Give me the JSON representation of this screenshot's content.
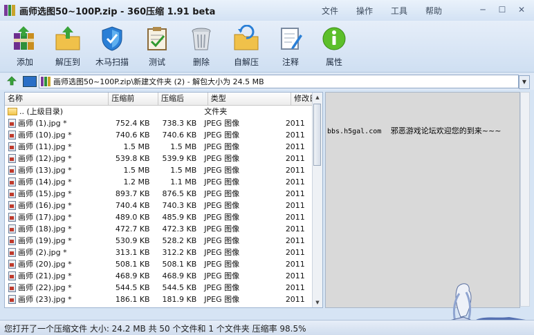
{
  "window": {
    "title": "画师选图50~100P.zip - 360压缩 1.91 beta",
    "menu": [
      "文件",
      "操作",
      "工具",
      "帮助"
    ],
    "controls": {
      "minimize": "─",
      "maximize": "☐",
      "close": "✕"
    }
  },
  "toolbar": [
    {
      "id": "add",
      "label": "添加"
    },
    {
      "id": "extract",
      "label": "解压到"
    },
    {
      "id": "scan",
      "label": "木马扫描"
    },
    {
      "id": "test",
      "label": "测试"
    },
    {
      "id": "delete",
      "label": "删除"
    },
    {
      "id": "selfextract",
      "label": "自解压"
    },
    {
      "id": "comment",
      "label": "注释"
    },
    {
      "id": "properties",
      "label": "属性"
    }
  ],
  "address": {
    "path": "画师选图50~100P.zip\\新建文件夹 (2) - 解包大小为 24.5 MB"
  },
  "list": {
    "columns": [
      "名称",
      "压缩前",
      "压缩后",
      "类型",
      "修改日"
    ],
    "rows": [
      {
        "name": ".. (上级目录)",
        "before": "",
        "after": "",
        "type": "文件夹",
        "mod": "",
        "folder": true
      },
      {
        "name": "画师 (1).jpg *",
        "before": "752.4 KB",
        "after": "738.3 KB",
        "type": "JPEG 图像",
        "mod": "2011"
      },
      {
        "name": "画师 (10).jpg *",
        "before": "740.6 KB",
        "after": "740.6 KB",
        "type": "JPEG 图像",
        "mod": "2011"
      },
      {
        "name": "画师 (11).jpg *",
        "before": "1.5 MB",
        "after": "1.5 MB",
        "type": "JPEG 图像",
        "mod": "2011"
      },
      {
        "name": "画师 (12).jpg *",
        "before": "539.8 KB",
        "after": "539.9 KB",
        "type": "JPEG 图像",
        "mod": "2011"
      },
      {
        "name": "画师 (13).jpg *",
        "before": "1.5 MB",
        "after": "1.5 MB",
        "type": "JPEG 图像",
        "mod": "2011"
      },
      {
        "name": "画师 (14).jpg *",
        "before": "1.2 MB",
        "after": "1.1 MB",
        "type": "JPEG 图像",
        "mod": "2011"
      },
      {
        "name": "画师 (15).jpg *",
        "before": "893.7 KB",
        "after": "876.5 KB",
        "type": "JPEG 图像",
        "mod": "2011"
      },
      {
        "name": "画师 (16).jpg *",
        "before": "740.4 KB",
        "after": "740.3 KB",
        "type": "JPEG 图像",
        "mod": "2011"
      },
      {
        "name": "画师 (17).jpg *",
        "before": "489.0 KB",
        "after": "485.9 KB",
        "type": "JPEG 图像",
        "mod": "2011"
      },
      {
        "name": "画师 (18).jpg *",
        "before": "472.7 KB",
        "after": "472.3 KB",
        "type": "JPEG 图像",
        "mod": "2011"
      },
      {
        "name": "画师 (19).jpg *",
        "before": "530.9 KB",
        "after": "528.2 KB",
        "type": "JPEG 图像",
        "mod": "2011"
      },
      {
        "name": "画师 (2).jpg *",
        "before": "313.1 KB",
        "after": "312.2 KB",
        "type": "JPEG 图像",
        "mod": "2011"
      },
      {
        "name": "画师 (20).jpg *",
        "before": "508.1 KB",
        "after": "508.1 KB",
        "type": "JPEG 图像",
        "mod": "2011"
      },
      {
        "name": "画师 (21).jpg *",
        "before": "468.9 KB",
        "after": "468.9 KB",
        "type": "JPEG 图像",
        "mod": "2011"
      },
      {
        "name": "画师 (22).jpg *",
        "before": "544.5 KB",
        "after": "544.5 KB",
        "type": "JPEG 图像",
        "mod": "2011"
      },
      {
        "name": "画师 (23).jpg *",
        "before": "186.1 KB",
        "after": "181.9 KB",
        "type": "JPEG 图像",
        "mod": "2011"
      }
    ]
  },
  "info_pane": {
    "url": "bbs.h5gal.com",
    "message": "邪恶游戏论坛欢迎您的到来~~~"
  },
  "status": {
    "text": "您打开了一个压缩文件 大小: 24.2 MB 共 50 个文件和 1 个文件夹 压缩率 98.5%"
  },
  "colors": {
    "accent": "#2b6fc6",
    "window_bg": "#d6e4f4"
  }
}
